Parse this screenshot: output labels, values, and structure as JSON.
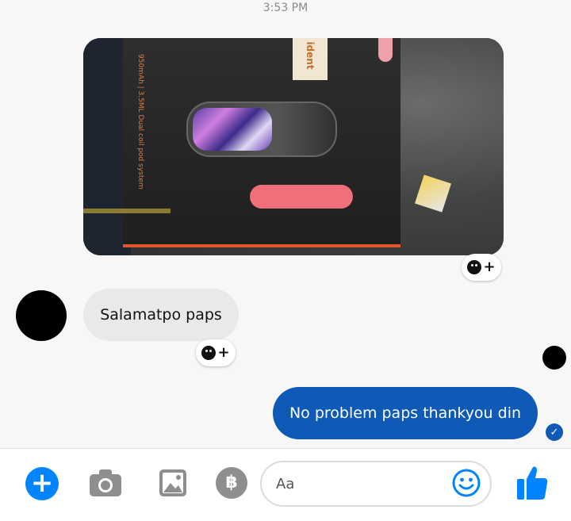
{
  "status": {
    "time": "3:53 PM"
  },
  "messages": {
    "photo": {
      "box_text": "950mAh | 3.5ML\nDual coil pod system",
      "label": "ident"
    },
    "incoming": {
      "text": "Salamatpo paps"
    },
    "outgoing": {
      "text": "No problem paps thankyou din"
    }
  },
  "reaction": {
    "icon": "add-reaction-icon",
    "plus": "+"
  },
  "composer": {
    "add_label": "+",
    "pay_label": "฿",
    "placeholder": "Aa",
    "icons": [
      "plus-icon",
      "camera-icon",
      "image-icon",
      "payment-icon",
      "emoji-icon",
      "thumbs-up-icon"
    ]
  },
  "colors": {
    "accent": "#0084ff",
    "outgoing_bubble": "#0f5ab7",
    "incoming_bubble": "#e9e9e9"
  }
}
